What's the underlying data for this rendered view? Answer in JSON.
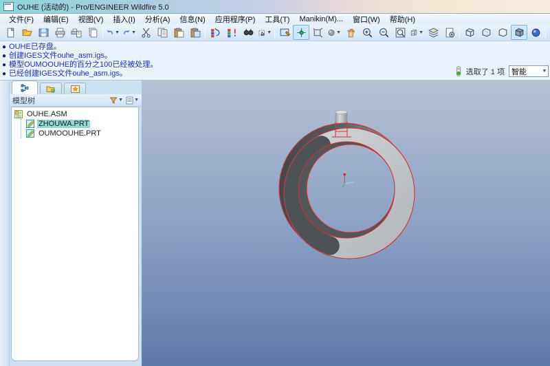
{
  "window": {
    "title": "OUHE (活动的) - Pro/ENGINEER Wildfire 5.0"
  },
  "menu": {
    "items": [
      "文件(F)",
      "编辑(E)",
      "视图(V)",
      "插入(I)",
      "分析(A)",
      "信息(N)",
      "应用程序(P)",
      "工具(T)",
      "Manikin(M)...",
      "窗口(W)",
      "帮助(H)"
    ]
  },
  "toolbar": {
    "groups": [
      [
        "new-file",
        "open-file",
        "save-file",
        "print",
        "print-preview",
        "erase-display"
      ],
      [
        "undo",
        "redo",
        "cut",
        "copy",
        "paste",
        "paste-special"
      ],
      [
        "regenerate",
        "regenerate-custom",
        "find",
        "select-box"
      ],
      [
        "repaint",
        "spin-center",
        "orient-mode",
        "shaded-view",
        "view-mode",
        "zoom-in",
        "zoom-out",
        "refit",
        "saved-views",
        "layers",
        "view-manager"
      ],
      [
        "wireframe-display",
        "hidden-line-display",
        "no-hidden-display",
        "shaded-display",
        "realistic-display"
      ],
      [
        "datum-plane-toggle",
        "datum-axis-toggle",
        "datum-point-toggle",
        "datum-csys-toggle",
        "annotation-toggle"
      ],
      [
        "context-help"
      ]
    ],
    "active": [
      "spin-center",
      "shaded-display",
      "annotation-toggle"
    ]
  },
  "messages": {
    "lines": [
      "OUHE已存盘。",
      "创建IGES文件ouhe_asm.igs。",
      "模型OUMOOUHE的百分之100已经被处理。",
      "已经创建IGES文件ouhe_asm.igs。"
    ]
  },
  "status": {
    "selected_text": "选取了 1 项",
    "filter_value": "智能"
  },
  "navigator": {
    "tabs": [
      "model-tree-tab",
      "folder-browser-tab",
      "favorites-tab"
    ],
    "header": "模型树",
    "tree": {
      "root": "OUHE.ASM",
      "items": [
        {
          "label": "ZHOUWA.PRT",
          "selected": true
        },
        {
          "label": "OUMOOUHE.PRT",
          "selected": false
        }
      ]
    }
  },
  "viewport": {
    "model": "ring-assembly-with-pin",
    "colors": {
      "face": "#c6cacd",
      "dark": "#4d5257",
      "highlight_edge": "#cf3333",
      "bg_top": "#b6c1d4",
      "bg_bottom": "#5d79a9"
    }
  }
}
